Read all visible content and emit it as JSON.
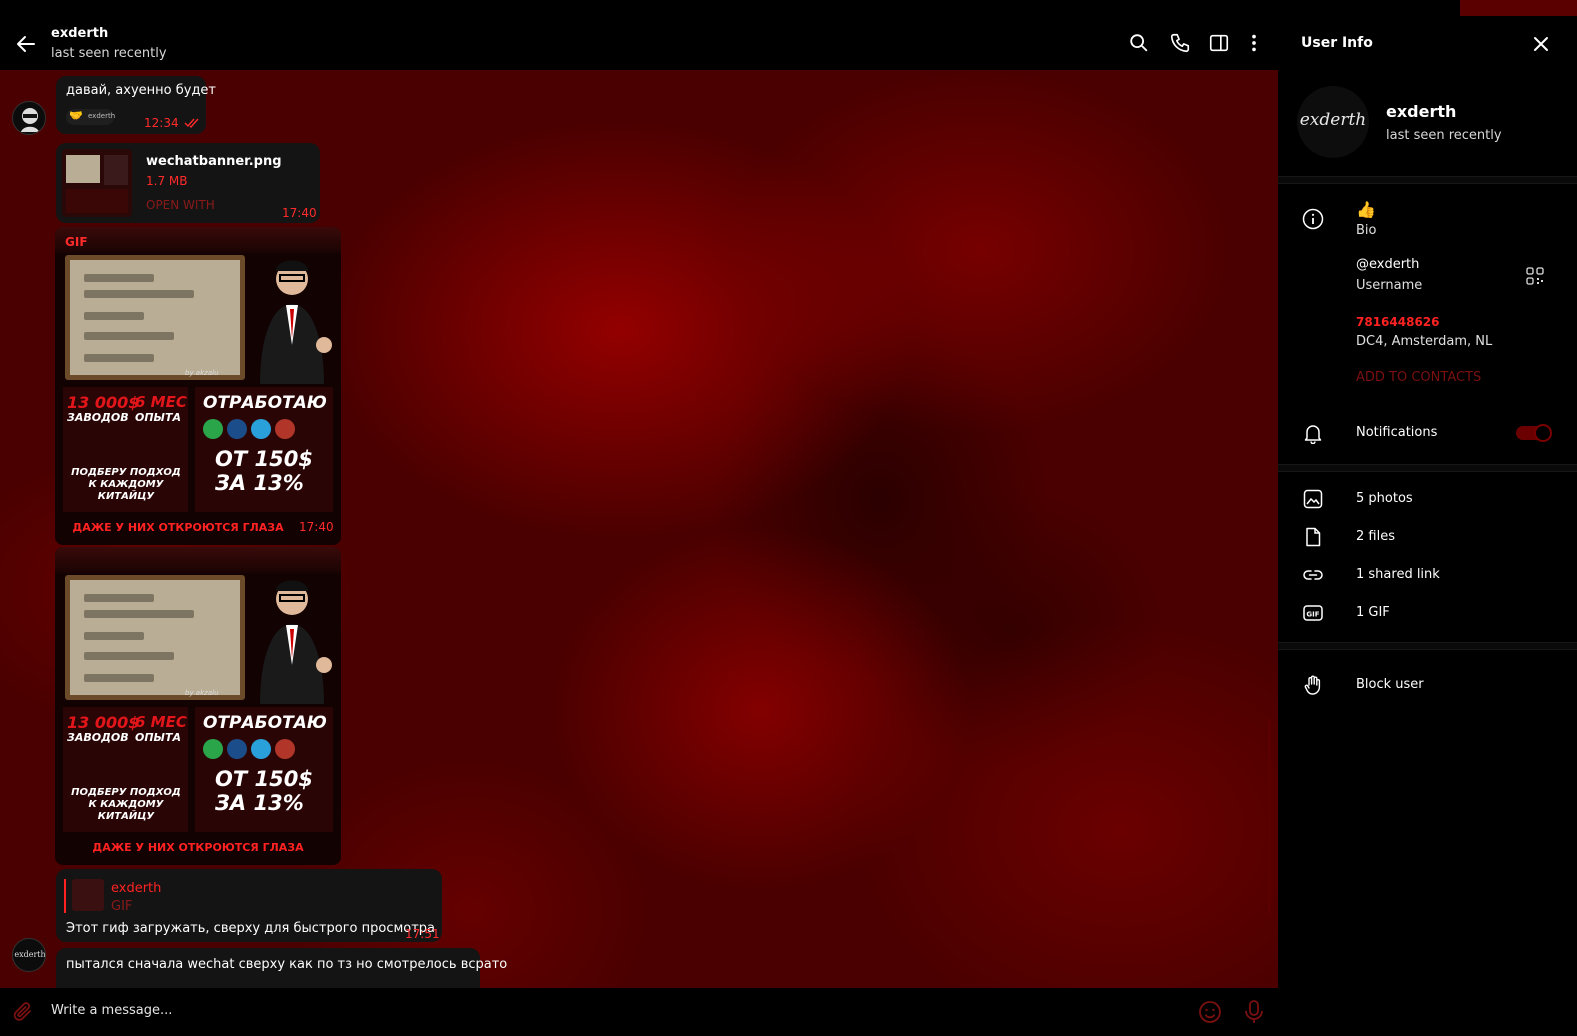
{
  "header": {
    "name": "exderth",
    "status": "last seen recently",
    "icons": [
      "back-arrow-icon",
      "search-icon",
      "phone-icon",
      "sidebar-toggle-icon",
      "more-vertical-icon"
    ]
  },
  "messages": {
    "m1": {
      "text": "давай, ахуенно будет",
      "reaction_label": "exderth",
      "time": "12:34"
    },
    "file": {
      "name": "wechatbanner.png",
      "size": "1.7 MB",
      "action": "OPEN WITH",
      "time": "17:40"
    },
    "gif1": {
      "badge": "GIF",
      "time": "17:40"
    },
    "banner": {
      "n1": "13 000$",
      "l1": "ЗАВОДОВ",
      "n2": "6 МЕС",
      "l2": "ОПЫТА",
      "work": "ОТРАБОТАЮ",
      "approach": "ПОДБЕРУ ПОДХОД К КАЖДОМУ КИТАЙЦУ",
      "price1": "ОТ 150$",
      "price2": "ЗА 13%",
      "caption": "ДАЖЕ У НИХ ОТКРОЮТСЯ ГЛАЗА",
      "sign": "by akzalu"
    },
    "reply": {
      "author": "exderth",
      "type": "GIF",
      "text": "Этот гиф загружать, сверху для быстрого просмотра",
      "time": "17:51"
    },
    "last": {
      "text": "пытался сначала wechat сверху как по тз но смотрелось всрато"
    }
  },
  "composer": {
    "placeholder": "Write a message..."
  },
  "panel": {
    "title": "User Info",
    "name": "exderth",
    "status": "last seen recently",
    "avatar_text": "exderth",
    "bio_emoji": "👍",
    "bio_label": "Bio",
    "username": "@exderth",
    "username_label": "Username",
    "phone": "7816448626",
    "dc": "DC4, Amsterdam, NL",
    "add_contacts": "ADD TO CONTACTS",
    "notifications": "Notifications",
    "photos": "5 photos",
    "files": "2 files",
    "links": "1 shared link",
    "gifs": "1 GIF",
    "block": "Block user"
  },
  "colors": {
    "accent": "#ff2222",
    "background": "#000000",
    "bubble": "#141414",
    "wallpaper": "#4a0000"
  }
}
